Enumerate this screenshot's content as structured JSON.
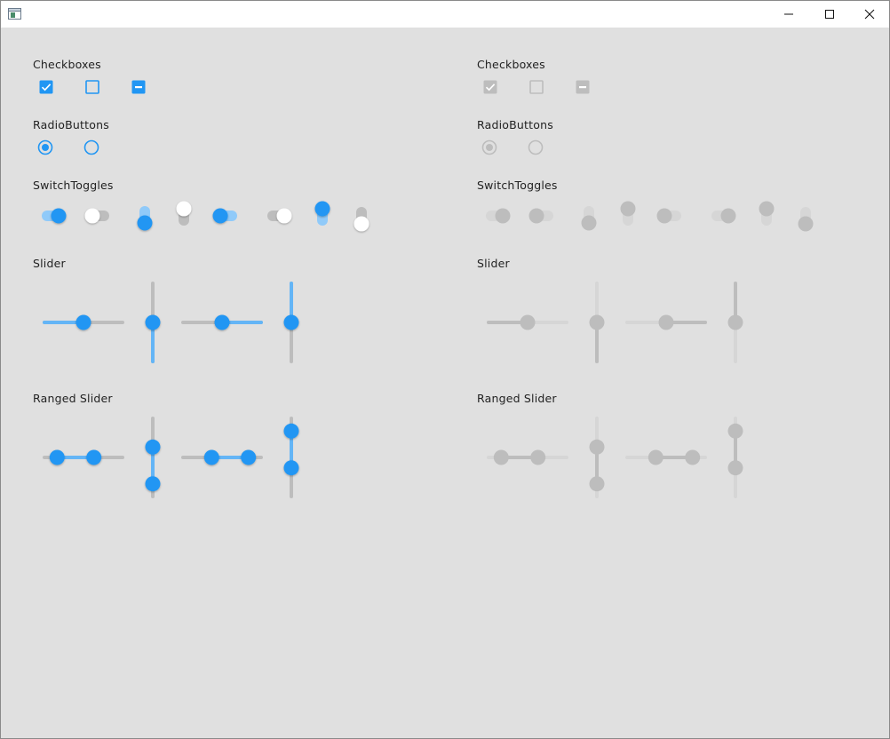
{
  "window": {
    "title": "",
    "buttons": [
      "minimize",
      "maximize",
      "close"
    ]
  },
  "colors": {
    "accent": "#2196f3",
    "accent_light": "#90caf9",
    "accent_track": "#64b5f6",
    "track": "#bdbdbd",
    "disabled": "#bdbdbd",
    "disabled_light": "#d6d6d6",
    "background": "#e0e0e0",
    "white": "#ffffff"
  },
  "panels": [
    {
      "state": "enabled",
      "sections": {
        "checkboxes": "Checkboxes",
        "radiobuttons": "RadioButtons",
        "switchtoggles": "SwitchToggles",
        "slider": "Slider",
        "ranged_slider": "Ranged Slider"
      },
      "checkboxes": [
        "checked",
        "unchecked",
        "indeterminate"
      ],
      "radiobuttons": [
        "checked",
        "unchecked"
      ],
      "switches": [
        {
          "orientation": "horizontal",
          "on": true
        },
        {
          "orientation": "horizontal",
          "on": false
        },
        {
          "orientation": "vertical",
          "on": true
        },
        {
          "orientation": "vertical",
          "on": false
        },
        {
          "orientation": "horizontal-reversed",
          "on": true
        },
        {
          "orientation": "horizontal-reversed",
          "on": false
        },
        {
          "orientation": "vertical-reversed",
          "on": true
        },
        {
          "orientation": "vertical-reversed",
          "on": false
        }
      ],
      "sliders": [
        {
          "orientation": "horizontal",
          "value": 0.5
        },
        {
          "orientation": "vertical",
          "value": 0.5
        },
        {
          "orientation": "horizontal-reversed",
          "value": 0.5
        },
        {
          "orientation": "vertical-reversed",
          "value": 0.5
        }
      ],
      "ranged_sliders": [
        {
          "orientation": "horizontal",
          "low": 0.17,
          "high": 0.63
        },
        {
          "orientation": "vertical",
          "low": 0.37,
          "high": 0.83
        },
        {
          "orientation": "horizontal",
          "low": 0.37,
          "high": 0.83
        },
        {
          "orientation": "vertical",
          "low": 0.17,
          "high": 0.63
        }
      ]
    },
    {
      "state": "disabled",
      "sections": {
        "checkboxes": "Checkboxes",
        "radiobuttons": "RadioButtons",
        "switchtoggles": "SwitchToggles",
        "slider": "Slider",
        "ranged_slider": "Ranged Slider"
      },
      "checkboxes": [
        "checked",
        "unchecked",
        "indeterminate"
      ],
      "radiobuttons": [
        "checked",
        "unchecked"
      ],
      "switches": [
        {
          "orientation": "horizontal",
          "on": true
        },
        {
          "orientation": "horizontal",
          "on": false
        },
        {
          "orientation": "vertical",
          "on": true
        },
        {
          "orientation": "vertical",
          "on": false
        },
        {
          "orientation": "horizontal-reversed",
          "on": true
        },
        {
          "orientation": "horizontal-reversed",
          "on": false
        },
        {
          "orientation": "vertical-reversed",
          "on": true
        },
        {
          "orientation": "vertical-reversed",
          "on": false
        }
      ],
      "sliders": [
        {
          "orientation": "horizontal",
          "value": 0.5
        },
        {
          "orientation": "vertical",
          "value": 0.5
        },
        {
          "orientation": "horizontal-reversed",
          "value": 0.5
        },
        {
          "orientation": "vertical-reversed",
          "value": 0.5
        }
      ],
      "ranged_sliders": [
        {
          "orientation": "horizontal",
          "low": 0.17,
          "high": 0.63
        },
        {
          "orientation": "vertical",
          "low": 0.37,
          "high": 0.83
        },
        {
          "orientation": "horizontal",
          "low": 0.37,
          "high": 0.83
        },
        {
          "orientation": "vertical",
          "low": 0.17,
          "high": 0.63
        }
      ]
    }
  ]
}
